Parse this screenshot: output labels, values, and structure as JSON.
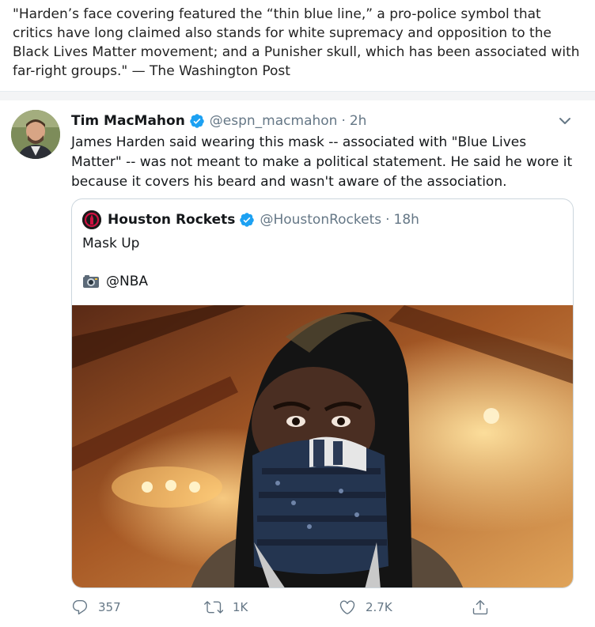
{
  "quote": {
    "text": "\"Harden’s face covering featured the “thin blue line,” a pro-police symbol that critics have long claimed also stands for white supremacy and opposition to the Black Lives Matter movement; and a Punisher skull, which has been associated with far-right groups.\" — The Washington Post"
  },
  "tweet": {
    "author_name": "Tim MacMahon",
    "handle": "@espn_macmahon",
    "separator": "·",
    "time": "2h",
    "text": "James Harden said wearing this mask -- associated with \"Blue Lives Matter\" -- was not meant to make a political statement. He said he wore it because it covers his beard and wasn't aware of the association.",
    "quoted": {
      "author_name": "Houston Rockets",
      "handle": "@HoustonRockets",
      "separator": "·",
      "time": "18h",
      "text": "Mask Up",
      "credit": "@NBA"
    },
    "actions": {
      "replies": "357",
      "retweets": "1K",
      "likes": "2.7K"
    }
  },
  "colors": {
    "verified": "#1da1f2",
    "muted": "#657786",
    "border": "#ccd6dd"
  },
  "icons": [
    "verified-badge-icon",
    "chevron-down-icon",
    "rockets-logo-icon",
    "camera-icon",
    "reply-icon",
    "retweet-icon",
    "like-icon",
    "share-icon"
  ]
}
